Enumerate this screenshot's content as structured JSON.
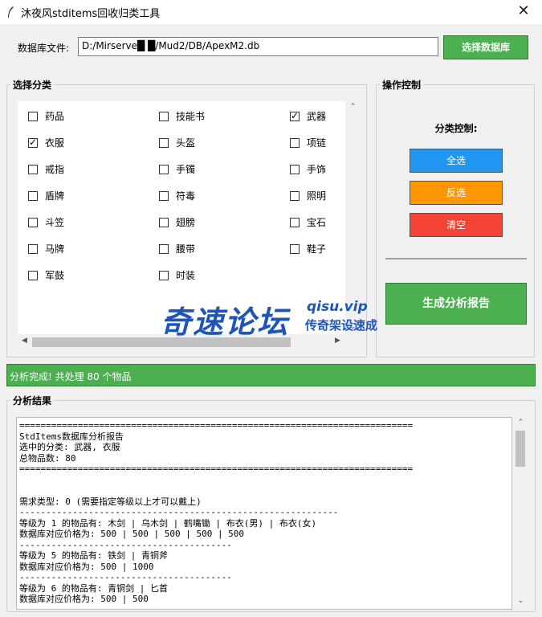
{
  "window": {
    "title": "沐夜风stditems回收归类工具"
  },
  "database": {
    "label": "数据库文件:",
    "path": "D:/Mirserve█ █/Mud2/DB/ApexM2.db",
    "select_button": "选择数据库"
  },
  "categories": {
    "legend": "选择分类",
    "items": [
      {
        "label": "药品",
        "checked": false
      },
      {
        "label": "技能书",
        "checked": false
      },
      {
        "label": "武器",
        "checked": true
      },
      {
        "label": "衣服",
        "checked": true
      },
      {
        "label": "头盔",
        "checked": false
      },
      {
        "label": "项链",
        "checked": false
      },
      {
        "label": "戒指",
        "checked": false
      },
      {
        "label": "手镯",
        "checked": false
      },
      {
        "label": "手饰",
        "checked": false
      },
      {
        "label": "盾牌",
        "checked": false
      },
      {
        "label": "符毒",
        "checked": false
      },
      {
        "label": "照明",
        "checked": false
      },
      {
        "label": "斗笠",
        "checked": false
      },
      {
        "label": "翅膀",
        "checked": false
      },
      {
        "label": "宝石",
        "checked": false
      },
      {
        "label": "马牌",
        "checked": false
      },
      {
        "label": "腰带",
        "checked": false
      },
      {
        "label": "鞋子",
        "checked": false
      },
      {
        "label": "军鼓",
        "checked": false
      },
      {
        "label": "时装",
        "checked": false
      }
    ]
  },
  "operations": {
    "legend": "操作控制",
    "subtitle": "分类控制:",
    "select_all": "全选",
    "invert": "反选",
    "clear": "清空",
    "generate_report": "生成分析报告",
    "colors": {
      "select_all": "#2196f3",
      "invert": "#ff9800",
      "clear": "#f44336",
      "generate": "#4caf50"
    }
  },
  "watermark": {
    "main": "奇速论坛",
    "url": "qisu.vip",
    "sub": "传奇架设速成"
  },
  "status": "分析完成! 共处理 80 个物品",
  "results": {
    "legend": "分析结果",
    "lines": [
      "==========================================================================",
      "StdItems数据库分析报告",
      "选中的分类: 武器, 衣服",
      "总物品数: 80",
      "==========================================================================",
      "",
      "",
      "需求类型: 0 (需要指定等级以上才可以戴上)",
      "------------------------------------------------------------",
      "等级为 1 的物品有: 木剑 | 乌木剑 | 鹤嘴锄 | 布衣(男) | 布衣(女)",
      "数据库对应价格为: 500 | 500 | 500 | 500 | 500",
      "----------------------------------------",
      "等级为 5 的物品有: 铁剑 | 青铜斧",
      "数据库对应价格为: 500 | 1000",
      "----------------------------------------",
      "等级为 6 的物品有: 青铜剑 | 匕首",
      "数据库对应价格为: 500 | 500"
    ]
  }
}
